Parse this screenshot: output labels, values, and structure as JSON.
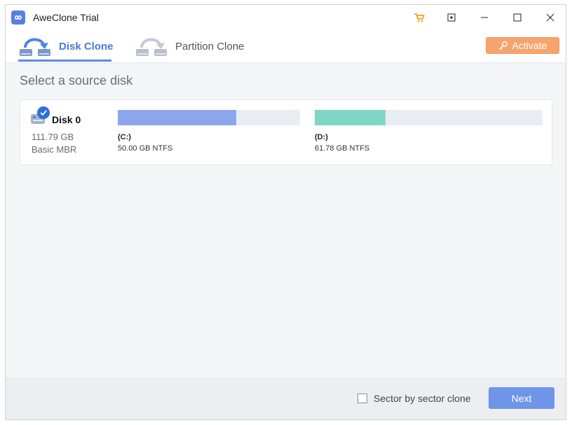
{
  "window": {
    "title": "AweClone Trial"
  },
  "tabs": [
    {
      "label": "Disk Clone",
      "active": true
    },
    {
      "label": "Partition Clone",
      "active": false
    }
  ],
  "activate": {
    "label": "Activate"
  },
  "main": {
    "heading": "Select a source disk"
  },
  "disk": {
    "name": "Disk 0",
    "size": "111.79 GB",
    "type": "Basic MBR",
    "partitions": [
      {
        "letter": "(C:)",
        "info": "50.00 GB NTFS",
        "used_fraction": 0.65,
        "color": "#8ca6ec"
      },
      {
        "letter": "(D:)",
        "info": "61.78 GB NTFS",
        "used_fraction": 0.31,
        "color": "#7fd6c5"
      }
    ]
  },
  "footer": {
    "checkbox_label": "Sector by sector clone",
    "checkbox_checked": false,
    "next_label": "Next"
  },
  "colors": {
    "accent": "#4d79d4",
    "activate": "#f6a46e",
    "next": "#6f95e9"
  }
}
